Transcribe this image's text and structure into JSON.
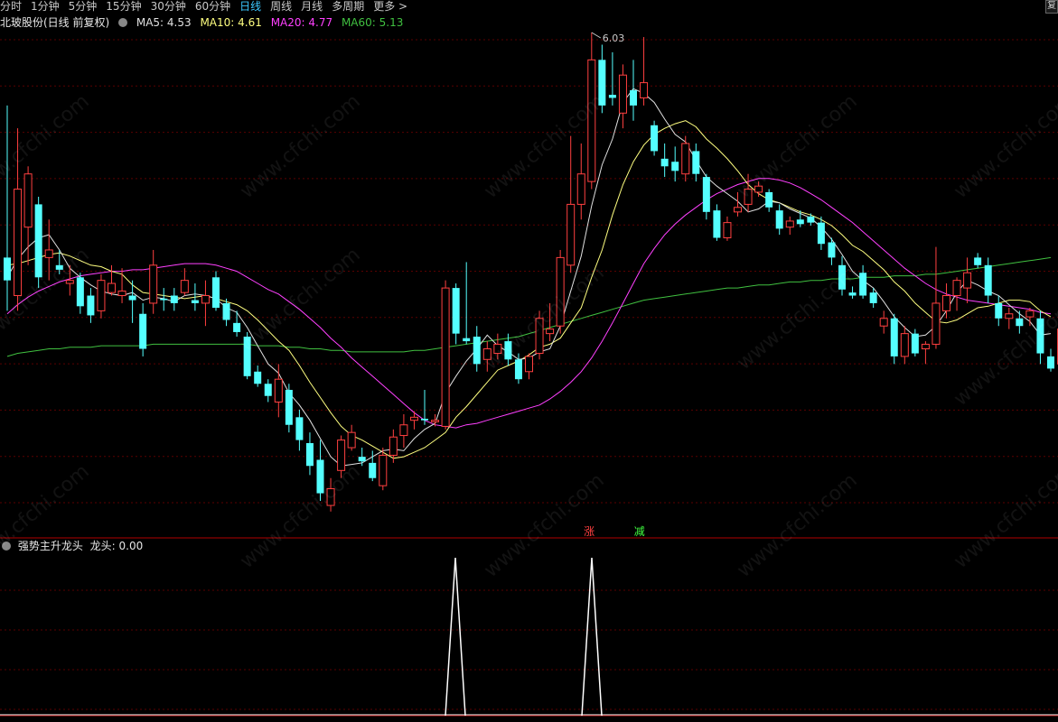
{
  "toolbar": {
    "periods": [
      "分时",
      "1分钟",
      "5分钟",
      "15分钟",
      "30分钟",
      "60分钟",
      "日线",
      "周线",
      "月线",
      "多周期",
      "更多 >"
    ],
    "active": "日线",
    "corner": "复"
  },
  "main_info": {
    "stock_name": "北玻股份(日线 前复权)",
    "ma5": "MA5: 4.53",
    "ma10": "MA10: 4.61",
    "ma20": "MA20: 4.77",
    "ma60": "MA60: 5.13"
  },
  "sub_info": {
    "indicator": "强势主升龙头",
    "value": "龙头: 0.00"
  },
  "signals": {
    "up": "涨",
    "down": "减"
  },
  "colors": {
    "up": "#ff4040",
    "down": "#54ffff",
    "ma5": "#e0e0e0",
    "ma10": "#ffff80",
    "ma20": "#ff40ff",
    "ma60": "#40c040",
    "grid": "#5a0000",
    "toolbar_active": "#3cc8ff"
  },
  "watermark": "www.cfchi.com",
  "chart_data": {
    "type": "candlestick",
    "max_label": "6.03",
    "candles": [
      {
        "o": 4.55,
        "h": 5.55,
        "l": 4.2,
        "c": 4.4
      },
      {
        "o": 4.3,
        "h": 5.4,
        "l": 4.2,
        "c": 5.0
      },
      {
        "o": 4.75,
        "h": 5.15,
        "l": 4.5,
        "c": 5.1
      },
      {
        "o": 4.9,
        "h": 4.95,
        "l": 4.35,
        "c": 4.42
      },
      {
        "o": 4.55,
        "h": 4.8,
        "l": 4.4,
        "c": 4.6
      },
      {
        "o": 4.5,
        "h": 4.6,
        "l": 4.44,
        "c": 4.47
      },
      {
        "o": 4.38,
        "h": 4.5,
        "l": 4.3,
        "c": 4.4
      },
      {
        "o": 4.42,
        "h": 4.45,
        "l": 4.18,
        "c": 4.23
      },
      {
        "o": 4.3,
        "h": 4.35,
        "l": 4.12,
        "c": 4.17
      },
      {
        "o": 4.2,
        "h": 4.44,
        "l": 4.15,
        "c": 4.4
      },
      {
        "o": 4.32,
        "h": 4.5,
        "l": 4.3,
        "c": 4.38
      },
      {
        "o": 4.3,
        "h": 4.48,
        "l": 4.25,
        "c": 4.33
      },
      {
        "o": 4.3,
        "h": 4.4,
        "l": 4.12,
        "c": 4.27
      },
      {
        "o": 4.18,
        "h": 4.25,
        "l": 3.9,
        "c": 3.95
      },
      {
        "o": 4.25,
        "h": 4.6,
        "l": 4.18,
        "c": 4.5
      },
      {
        "o": 4.28,
        "h": 4.35,
        "l": 4.2,
        "c": 4.27
      },
      {
        "o": 4.3,
        "h": 4.35,
        "l": 4.2,
        "c": 4.25
      },
      {
        "o": 4.32,
        "h": 4.48,
        "l": 4.3,
        "c": 4.4
      },
      {
        "o": 4.27,
        "h": 4.38,
        "l": 4.2,
        "c": 4.25
      },
      {
        "o": 4.25,
        "h": 4.4,
        "l": 4.1,
        "c": 4.3
      },
      {
        "o": 4.42,
        "h": 4.46,
        "l": 4.2,
        "c": 4.22
      },
      {
        "o": 4.25,
        "h": 4.28,
        "l": 4.1,
        "c": 4.14
      },
      {
        "o": 4.12,
        "h": 4.2,
        "l": 4.03,
        "c": 4.06
      },
      {
        "o": 4.03,
        "h": 4.06,
        "l": 3.75,
        "c": 3.77
      },
      {
        "o": 3.8,
        "h": 3.84,
        "l": 3.7,
        "c": 3.72
      },
      {
        "o": 3.72,
        "h": 3.75,
        "l": 3.6,
        "c": 3.64
      },
      {
        "o": 3.6,
        "h": 3.85,
        "l": 3.5,
        "c": 3.75
      },
      {
        "o": 3.68,
        "h": 3.72,
        "l": 3.4,
        "c": 3.45
      },
      {
        "o": 3.5,
        "h": 3.55,
        "l": 3.28,
        "c": 3.35
      },
      {
        "o": 3.33,
        "h": 3.4,
        "l": 3.12,
        "c": 3.18
      },
      {
        "o": 3.22,
        "h": 3.35,
        "l": 2.95,
        "c": 3.0
      },
      {
        "o": 2.92,
        "h": 3.1,
        "l": 2.88,
        "c": 3.03
      },
      {
        "o": 3.15,
        "h": 3.38,
        "l": 3.1,
        "c": 3.35
      },
      {
        "o": 3.3,
        "h": 3.45,
        "l": 3.28,
        "c": 3.4
      },
      {
        "o": 3.24,
        "h": 3.3,
        "l": 3.18,
        "c": 3.21
      },
      {
        "o": 3.2,
        "h": 3.28,
        "l": 3.08,
        "c": 3.1
      },
      {
        "o": 3.05,
        "h": 3.3,
        "l": 3.02,
        "c": 3.25
      },
      {
        "o": 3.25,
        "h": 3.42,
        "l": 3.2,
        "c": 3.37
      },
      {
        "o": 3.38,
        "h": 3.52,
        "l": 3.3,
        "c": 3.45
      },
      {
        "o": 3.48,
        "h": 3.54,
        "l": 3.42,
        "c": 3.5
      },
      {
        "o": 3.49,
        "h": 3.68,
        "l": 3.45,
        "c": 3.48
      },
      {
        "o": 3.47,
        "h": 3.52,
        "l": 3.44,
        "c": 3.48
      },
      {
        "o": 3.44,
        "h": 4.4,
        "l": 3.42,
        "c": 4.35
      },
      {
        "o": 4.35,
        "h": 4.38,
        "l": 3.98,
        "c": 4.05
      },
      {
        "o": 4.02,
        "h": 4.52,
        "l": 3.98,
        "c": 4.0
      },
      {
        "o": 4.03,
        "h": 4.1,
        "l": 3.8,
        "c": 3.85
      },
      {
        "o": 3.88,
        "h": 4.0,
        "l": 3.8,
        "c": 3.95
      },
      {
        "o": 3.92,
        "h": 4.05,
        "l": 3.88,
        "c": 3.98
      },
      {
        "o": 4.0,
        "h": 4.05,
        "l": 3.84,
        "c": 3.88
      },
      {
        "o": 3.88,
        "h": 3.92,
        "l": 3.72,
        "c": 3.75
      },
      {
        "o": 3.8,
        "h": 3.92,
        "l": 3.75,
        "c": 3.9
      },
      {
        "o": 3.92,
        "h": 4.2,
        "l": 3.88,
        "c": 4.15
      },
      {
        "o": 4.05,
        "h": 4.25,
        "l": 4.0,
        "c": 4.08
      },
      {
        "o": 4.1,
        "h": 4.6,
        "l": 4.05,
        "c": 4.55
      },
      {
        "o": 4.5,
        "h": 5.35,
        "l": 4.45,
        "c": 4.9
      },
      {
        "o": 4.9,
        "h": 5.3,
        "l": 4.8,
        "c": 5.1
      },
      {
        "o": 5.05,
        "h": 6.03,
        "l": 5.0,
        "c": 5.85
      },
      {
        "o": 5.85,
        "h": 5.95,
        "l": 5.5,
        "c": 5.55
      },
      {
        "o": 5.62,
        "h": 5.9,
        "l": 5.55,
        "c": 5.6
      },
      {
        "o": 5.5,
        "h": 5.82,
        "l": 5.4,
        "c": 5.75
      },
      {
        "o": 5.65,
        "h": 5.85,
        "l": 5.45,
        "c": 5.55
      },
      {
        "o": 5.6,
        "h": 6.0,
        "l": 5.55,
        "c": 5.7
      },
      {
        "o": 5.42,
        "h": 5.45,
        "l": 5.22,
        "c": 5.25
      },
      {
        "o": 5.2,
        "h": 5.3,
        "l": 5.08,
        "c": 5.15
      },
      {
        "o": 5.18,
        "h": 5.28,
        "l": 5.05,
        "c": 5.12
      },
      {
        "o": 5.1,
        "h": 5.35,
        "l": 5.05,
        "c": 5.3
      },
      {
        "o": 5.25,
        "h": 5.3,
        "l": 5.05,
        "c": 5.1
      },
      {
        "o": 5.08,
        "h": 5.1,
        "l": 4.8,
        "c": 4.85
      },
      {
        "o": 4.86,
        "h": 4.9,
        "l": 4.66,
        "c": 4.68
      },
      {
        "o": 4.68,
        "h": 4.82,
        "l": 4.66,
        "c": 4.78
      },
      {
        "o": 4.85,
        "h": 4.98,
        "l": 4.82,
        "c": 4.88
      },
      {
        "o": 4.9,
        "h": 5.1,
        "l": 4.85,
        "c": 5.0
      },
      {
        "o": 4.98,
        "h": 5.05,
        "l": 4.95,
        "c": 5.02
      },
      {
        "o": 4.98,
        "h": 5.0,
        "l": 4.85,
        "c": 4.88
      },
      {
        "o": 4.86,
        "h": 4.9,
        "l": 4.7,
        "c": 4.74
      },
      {
        "o": 4.75,
        "h": 4.82,
        "l": 4.7,
        "c": 4.79
      },
      {
        "o": 4.8,
        "h": 4.86,
        "l": 4.75,
        "c": 4.77
      },
      {
        "o": 4.82,
        "h": 4.84,
        "l": 4.76,
        "c": 4.78
      },
      {
        "o": 4.78,
        "h": 4.82,
        "l": 4.6,
        "c": 4.64
      },
      {
        "o": 4.65,
        "h": 4.68,
        "l": 4.5,
        "c": 4.55
      },
      {
        "o": 4.5,
        "h": 4.56,
        "l": 4.3,
        "c": 4.34
      },
      {
        "o": 4.32,
        "h": 4.36,
        "l": 4.28,
        "c": 4.3
      },
      {
        "o": 4.45,
        "h": 4.5,
        "l": 4.28,
        "c": 4.3
      },
      {
        "o": 4.32,
        "h": 4.35,
        "l": 4.22,
        "c": 4.25
      },
      {
        "o": 4.1,
        "h": 4.2,
        "l": 4.05,
        "c": 4.15
      },
      {
        "o": 4.15,
        "h": 4.18,
        "l": 3.85,
        "c": 3.9
      },
      {
        "o": 3.9,
        "h": 4.1,
        "l": 3.85,
        "c": 4.05
      },
      {
        "o": 4.05,
        "h": 4.08,
        "l": 3.9,
        "c": 3.92
      },
      {
        "o": 3.95,
        "h": 4.0,
        "l": 3.85,
        "c": 3.98
      },
      {
        "o": 3.98,
        "h": 4.62,
        "l": 3.95,
        "c": 4.25
      },
      {
        "o": 4.2,
        "h": 4.38,
        "l": 4.15,
        "c": 4.3
      },
      {
        "o": 4.3,
        "h": 4.42,
        "l": 4.2,
        "c": 4.4
      },
      {
        "o": 4.35,
        "h": 4.55,
        "l": 4.25,
        "c": 4.45
      },
      {
        "o": 4.55,
        "h": 4.58,
        "l": 4.48,
        "c": 4.5
      },
      {
        "o": 4.5,
        "h": 4.55,
        "l": 4.25,
        "c": 4.3
      },
      {
        "o": 4.25,
        "h": 4.3,
        "l": 4.1,
        "c": 4.15
      },
      {
        "o": 4.15,
        "h": 4.22,
        "l": 4.08,
        "c": 4.18
      },
      {
        "o": 4.15,
        "h": 4.2,
        "l": 4.05,
        "c": 4.1
      },
      {
        "o": 4.16,
        "h": 4.22,
        "l": 4.1,
        "c": 4.2
      },
      {
        "o": 4.15,
        "h": 4.2,
        "l": 3.85,
        "c": 3.92
      },
      {
        "o": 3.9,
        "h": 3.95,
        "l": 3.8,
        "c": 3.82
      },
      {
        "o": 3.85,
        "h": 4.2,
        "l": 3.82,
        "c": 4.08
      }
    ],
    "ma5": [
      4.42,
      4.54,
      4.62,
      4.68,
      4.7,
      4.6,
      4.48,
      4.42,
      4.37,
      4.33,
      4.31,
      4.3,
      4.32,
      4.27,
      4.29,
      4.28,
      4.26,
      4.3,
      4.31,
      4.3,
      4.28,
      4.22,
      4.19,
      4.09,
      3.97,
      3.85,
      3.79,
      3.66,
      3.58,
      3.48,
      3.36,
      3.24,
      3.18,
      3.19,
      3.2,
      3.24,
      3.28,
      3.29,
      3.28,
      3.36,
      3.42,
      3.46,
      3.66,
      3.77,
      3.87,
      3.95,
      4.04,
      3.97,
      3.93,
      3.88,
      3.89,
      3.93,
      3.95,
      4.1,
      4.33,
      4.56,
      4.89,
      5.16,
      5.33,
      5.57,
      5.66,
      5.63,
      5.57,
      5.46,
      5.36,
      5.31,
      5.19,
      5.08,
      5.02,
      4.97,
      4.92,
      4.85,
      4.87,
      4.92,
      4.91,
      4.87,
      4.84,
      4.81,
      4.75,
      4.67,
      4.57,
      4.46,
      4.4,
      4.35,
      4.26,
      4.16,
      4.09,
      4.03,
      4.04,
      4.1,
      4.2,
      4.32,
      4.4,
      4.37,
      4.33,
      4.3,
      4.24,
      4.18,
      4.13,
      4.04,
      4.05
    ],
    "ma10": [
      4.5,
      4.51,
      4.53,
      4.55,
      4.57,
      4.58,
      4.56,
      4.53,
      4.5,
      4.49,
      4.46,
      4.44,
      4.37,
      4.32,
      4.31,
      4.3,
      4.29,
      4.28,
      4.29,
      4.3,
      4.28,
      4.26,
      4.24,
      4.2,
      4.14,
      4.07,
      4.0,
      3.94,
      3.84,
      3.73,
      3.63,
      3.53,
      3.44,
      3.38,
      3.35,
      3.31,
      3.27,
      3.23,
      3.24,
      3.27,
      3.3,
      3.35,
      3.4,
      3.5,
      3.57,
      3.65,
      3.73,
      3.81,
      3.84,
      3.87,
      3.91,
      3.96,
      3.98,
      4.02,
      4.12,
      4.22,
      4.42,
      4.6,
      4.83,
      5.03,
      5.18,
      5.29,
      5.36,
      5.4,
      5.43,
      5.45,
      5.41,
      5.33,
      5.27,
      5.2,
      5.12,
      5.03,
      4.97,
      4.93,
      4.91,
      4.88,
      4.85,
      4.83,
      4.8,
      4.76,
      4.7,
      4.63,
      4.59,
      4.53,
      4.47,
      4.39,
      4.33,
      4.25,
      4.19,
      4.13,
      4.12,
      4.14,
      4.18,
      4.22,
      4.23,
      4.25,
      4.27,
      4.27,
      4.26,
      4.2,
      4.16
    ],
    "ma20": [
      4.18,
      4.24,
      4.29,
      4.33,
      4.36,
      4.39,
      4.41,
      4.43,
      4.44,
      4.45,
      4.46,
      4.46,
      4.47,
      4.47,
      4.48,
      4.49,
      4.5,
      4.51,
      4.51,
      4.51,
      4.5,
      4.48,
      4.46,
      4.42,
      4.38,
      4.34,
      4.31,
      4.26,
      4.21,
      4.15,
      4.09,
      4.02,
      3.96,
      3.89,
      3.83,
      3.77,
      3.71,
      3.65,
      3.59,
      3.53,
      3.48,
      3.45,
      3.44,
      3.43,
      3.45,
      3.46,
      3.48,
      3.5,
      3.52,
      3.54,
      3.56,
      3.58,
      3.62,
      3.67,
      3.73,
      3.8,
      3.89,
      4.0,
      4.12,
      4.25,
      4.38,
      4.51,
      4.61,
      4.7,
      4.77,
      4.83,
      4.88,
      4.93,
      4.97,
      5.0,
      5.03,
      5.05,
      5.07,
      5.07,
      5.06,
      5.04,
      5.01,
      4.97,
      4.93,
      4.88,
      4.83,
      4.78,
      4.72,
      4.66,
      4.6,
      4.54,
      4.48,
      4.43,
      4.38,
      4.34,
      4.31,
      4.29,
      4.27,
      4.26,
      4.25,
      4.24,
      4.23,
      4.22,
      4.21,
      4.19,
      4.18
    ],
    "ma60": [
      3.9,
      3.92,
      3.93,
      3.94,
      3.95,
      3.95,
      3.96,
      3.96,
      3.96,
      3.97,
      3.97,
      3.97,
      3.97,
      3.97,
      3.98,
      3.98,
      3.98,
      3.98,
      3.98,
      3.98,
      3.98,
      3.98,
      3.98,
      3.98,
      3.97,
      3.97,
      3.97,
      3.96,
      3.96,
      3.95,
      3.95,
      3.94,
      3.94,
      3.93,
      3.93,
      3.93,
      3.93,
      3.93,
      3.93,
      3.94,
      3.94,
      3.95,
      3.96,
      3.97,
      3.98,
      3.99,
      4.0,
      4.01,
      4.02,
      4.03,
      4.05,
      4.07,
      4.09,
      4.11,
      4.13,
      4.15,
      4.17,
      4.19,
      4.21,
      4.23,
      4.25,
      4.27,
      4.28,
      4.29,
      4.3,
      4.31,
      4.32,
      4.33,
      4.34,
      4.35,
      4.35,
      4.36,
      4.37,
      4.37,
      4.38,
      4.39,
      4.39,
      4.4,
      4.4,
      4.41,
      4.41,
      4.41,
      4.42,
      4.42,
      4.42,
      4.43,
      4.43,
      4.43,
      4.44,
      4.44,
      4.45,
      4.46,
      4.47,
      4.48,
      4.49,
      4.5,
      4.51,
      4.52,
      4.53,
      4.54,
      4.55
    ],
    "signal_indices": [
      42,
      54
    ],
    "signal_values": [
      0,
      1,
      1
    ]
  }
}
